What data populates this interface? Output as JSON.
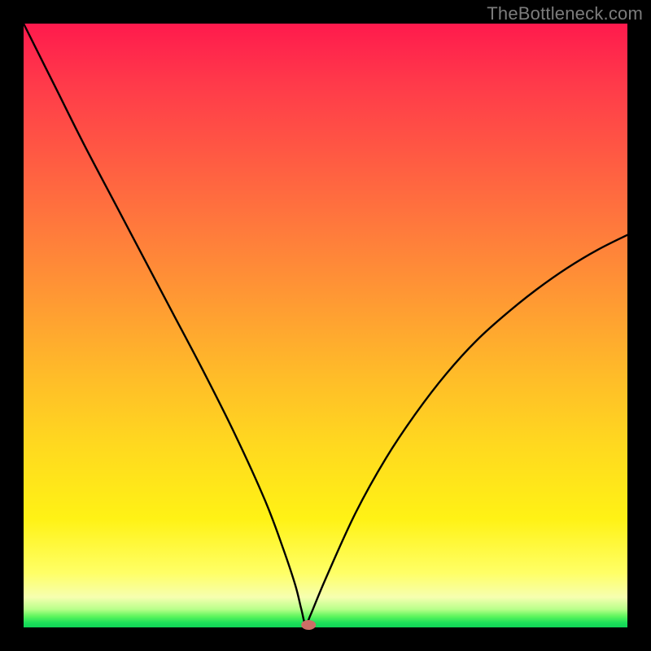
{
  "watermark": "TheBottleneck.com",
  "chart_data": {
    "type": "line",
    "title": "",
    "xlabel": "",
    "ylabel": "",
    "xlim": [
      0,
      100
    ],
    "ylim": [
      0,
      100
    ],
    "grid": false,
    "series": [
      {
        "name": "bottleneck-curve",
        "x": [
          0,
          5,
          10,
          15,
          20,
          25,
          30,
          35,
          40,
          43,
          45,
          46,
          46.7,
          47.5,
          50,
          55,
          60,
          65,
          70,
          75,
          80,
          85,
          90,
          95,
          100
        ],
        "values": [
          100,
          90,
          80,
          70.5,
          61,
          51.5,
          42,
          32,
          21,
          13,
          7,
          3,
          0.5,
          2,
          8,
          19,
          28,
          35.5,
          42,
          47.5,
          52,
          56,
          59.5,
          62.5,
          65
        ]
      }
    ],
    "marker": {
      "x": 47.2,
      "y": 0.4,
      "color": "#cc6e66"
    },
    "background_gradient": {
      "top": "#ff1a4d",
      "middle": "#ffd91f",
      "bottom": "#0fd457"
    }
  }
}
